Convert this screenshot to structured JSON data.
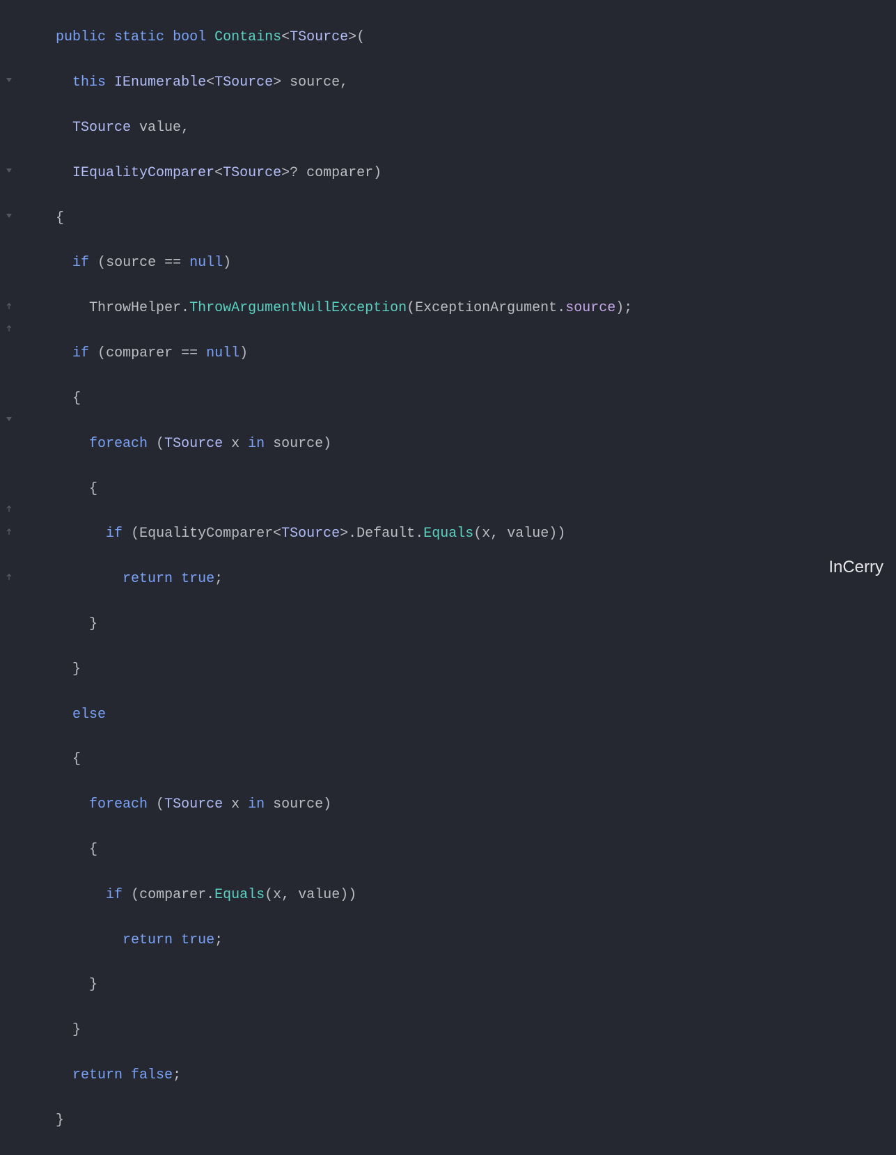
{
  "watermark": "InCerry",
  "code": {
    "l1": {
      "kw_public": "public",
      "kw_static": "static",
      "kw_bool": "bool",
      "fn": "Contains",
      "lt": "<",
      "tsource": "TSource",
      "gt": ">",
      "paren": "("
    },
    "l2": {
      "kw_this": "this",
      "type": "IEnumerable",
      "lt": "<",
      "tsource": "TSource",
      "gt": ">",
      "ident": "source",
      "comma": ","
    },
    "l3": {
      "tsource": "TSource",
      "ident": "value",
      "comma": ","
    },
    "l4": {
      "type": "IEqualityComparer",
      "lt": "<",
      "tsource": "TSource",
      "gt": ">",
      "q": "?",
      "ident": "comparer",
      "paren": ")"
    },
    "l5": {
      "brace": "{"
    },
    "l6": {
      "kw_if": "if",
      "po": "(",
      "ident": "source",
      "eq": "==",
      "null": "null",
      "pc": ")"
    },
    "l7": {
      "cls": "ThrowHelper",
      "dot": ".",
      "fn": "ThrowArgumentNullException",
      "po": "(",
      "arg": "ExceptionArgument",
      "dot2": ".",
      "prop": "source",
      "pc": ")",
      "semi": ";"
    },
    "l8": {
      "kw_if": "if",
      "po": "(",
      "ident": "comparer",
      "eq": "==",
      "null": "null",
      "pc": ")"
    },
    "l9": {
      "brace": "{"
    },
    "l10": {
      "kw_foreach": "foreach",
      "po": "(",
      "tsource": "TSource",
      "x": "x",
      "kw_in": "in",
      "ident": "source",
      "pc": ")"
    },
    "l11": {
      "brace": "{"
    },
    "l12": {
      "kw_if": "if",
      "po": "(",
      "cls": "EqualityComparer",
      "lt": "<",
      "tsource": "TSource",
      "gt": ">",
      "dot": ".",
      "prop": "Default",
      "dot2": ".",
      "fn": "Equals",
      "po2": "(",
      "x": "x",
      "comma": ",",
      "val": "value",
      "pc2": ")",
      "pc": ")"
    },
    "l13": {
      "kw_return": "return",
      "true": "true",
      "semi": ";"
    },
    "l14": {
      "brace": "}"
    },
    "l15": {
      "brace": "}"
    },
    "l16": {
      "kw_else": "else"
    },
    "l17": {
      "brace": "{"
    },
    "l18": {
      "kw_foreach": "foreach",
      "po": "(",
      "tsource": "TSource",
      "x": "x",
      "kw_in": "in",
      "ident": "source",
      "pc": ")"
    },
    "l19": {
      "brace": "{"
    },
    "l20": {
      "kw_if": "if",
      "po": "(",
      "ident": "comparer",
      "dot": ".",
      "fn": "Equals",
      "po2": "(",
      "x": "x",
      "comma": ",",
      "val": "value",
      "pc2": ")",
      "pc": ")"
    },
    "l21": {
      "kw_return": "return",
      "true": "true",
      "semi": ";"
    },
    "l22": {
      "brace": "}"
    },
    "l23": {
      "brace": "}"
    },
    "l24": {
      "kw_return": "return",
      "false": "false",
      "semi": ";"
    },
    "l25": {
      "brace": "}"
    }
  }
}
